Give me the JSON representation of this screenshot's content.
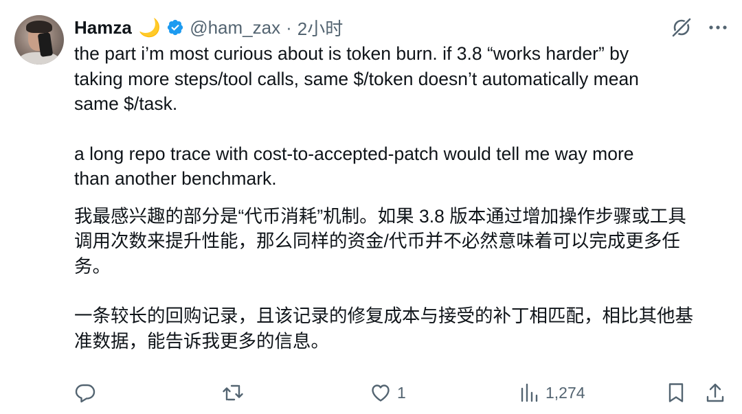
{
  "tweet": {
    "author_name": "Hamza",
    "emoji": "🌙",
    "handle": "@ham_zax",
    "separator": "·",
    "time": "2小时",
    "paragraphs": [
      "the part i’m most curious about is token burn. if 3.8 “works harder” by\ntaking more steps/tool calls, same $/token doesn’t automatically mean\nsame $/task.",
      "a long repo trace with cost-to-accepted-patch would tell me way more\nthan another benchmark.",
      "我最感兴趣的部分是“代币消耗”机制。如果 3.8 版本通过增加操作步骤或工具\n调用次数来提升性能，那么同样的资金/代币并不必然意味着可以完成更多任\n务。",
      "一条较长的回购记录，且该记录的修复成本与接受的补丁相匹配，相比其他基\n准数据，能告诉我更多的信息。"
    ]
  },
  "actions": {
    "reply_count": "",
    "retweet_count": "",
    "like_count": "1",
    "views_count": "1,274"
  },
  "icons": {
    "verified": "verified-badge-icon",
    "grok": "grok-icon",
    "more": "more-icon",
    "reply": "reply-icon",
    "retweet": "retweet-icon",
    "like": "heart-icon",
    "views": "views-icon",
    "bookmark": "bookmark-icon",
    "share": "share-icon"
  },
  "colors": {
    "text": "#0f1419",
    "secondary": "#536471",
    "verified": "#1d9bf0",
    "moon": "#f5c542"
  }
}
